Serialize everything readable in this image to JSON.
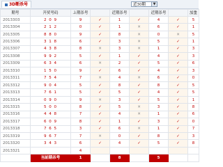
{
  "tab": {
    "title": "3D断杀号"
  },
  "filter": {
    "selected": "近30期"
  },
  "columns": [
    "期号",
    "开奖号码",
    "上期杀号",
    "",
    "近期杀号",
    "",
    "近期杀号",
    "",
    "加重"
  ],
  "rows": [
    {
      "issue": "2013303",
      "draw": "2 0 9",
      "k1": "9",
      "m1": "✓",
      "k2": "1",
      "m2": "✓",
      "k3": "4",
      "m3": "✓",
      "w": "5"
    },
    {
      "issue": "2013304",
      "draw": "2 1 2",
      "k1": "0",
      "m1": "✓",
      "k2": "1",
      "m2": "✕",
      "k3": "6",
      "m3": "✓",
      "w": "1"
    },
    {
      "issue": "2013305",
      "draw": "8 8 0",
      "k1": "9",
      "m1": "✓",
      "k2": "8",
      "m2": "✕",
      "k3": "0",
      "m3": "✕",
      "w": "5"
    },
    {
      "issue": "2013306",
      "draw": "3 1 8",
      "k1": "6",
      "m1": "✓",
      "k2": "3",
      "m2": "✕",
      "k3": "5",
      "m3": "✓",
      "w": "1"
    },
    {
      "issue": "2013307",
      "draw": "4 3 8",
      "k1": "8",
      "m1": "✕",
      "k2": "3",
      "m2": "✕",
      "k3": "1",
      "m3": "✓",
      "w": "3"
    },
    {
      "issue": "2013308",
      "draw": "9 9 2",
      "k1": "5",
      "m1": "✓",
      "k2": "1",
      "m2": "✓",
      "k3": "4",
      "m3": "✓",
      "w": "3"
    },
    {
      "issue": "2013309",
      "draw": "6 3 4",
      "k1": "6",
      "m1": "✕",
      "k2": "2",
      "m2": "✓",
      "k3": "5",
      "m3": "✓",
      "w": "6"
    },
    {
      "issue": "2013310",
      "draw": "1 5 0",
      "k1": "9",
      "m1": "✓",
      "k2": "6",
      "m2": "✓",
      "k3": "4",
      "m3": "✓",
      "w": "3"
    },
    {
      "issue": "2013311",
      "draw": "7 5 4",
      "k1": "7",
      "m1": "✕",
      "k2": "4",
      "m2": "✕",
      "k3": "6",
      "m3": "✓",
      "w": "0"
    },
    {
      "issue": "2013312",
      "draw": "9 0 4",
      "k1": "5",
      "m1": "✓",
      "k2": "8",
      "m2": "✓",
      "k3": "8",
      "m3": "✓",
      "w": "5"
    },
    {
      "issue": "2013313",
      "draw": "7 6 1",
      "k1": "5",
      "m1": "✓",
      "k2": "5",
      "m2": "✓",
      "k3": "4",
      "m3": "✓",
      "w": "5"
    },
    {
      "issue": "2013314",
      "draw": "0 9 0",
      "k1": "9",
      "m1": "✕",
      "k2": "3",
      "m2": "✓",
      "k3": "5",
      "m3": "✓",
      "w": "1"
    },
    {
      "issue": "2013315",
      "draw": "5 0 0",
      "k1": "8",
      "m1": "✓",
      "k2": "5",
      "m2": "✕",
      "k3": "3",
      "m3": "✓",
      "w": "8"
    },
    {
      "issue": "2013316",
      "draw": "4 4 8",
      "k1": "7",
      "m1": "✓",
      "k2": "4",
      "m2": "✕",
      "k3": "1",
      "m3": "✓",
      "w": "6"
    },
    {
      "issue": "2013317",
      "draw": "6 0 9",
      "k1": "8",
      "m1": "✓",
      "k2": "1",
      "m2": "✓",
      "k3": "3",
      "m3": "✓",
      "w": "0"
    },
    {
      "issue": "2013318",
      "draw": "7 6 5",
      "k1": "3",
      "m1": "✓",
      "k2": "6",
      "m2": "✕",
      "k3": "1",
      "m3": "✓",
      "w": "7"
    },
    {
      "issue": "2013319",
      "draw": "9 6 7",
      "k1": "7",
      "m1": "✕",
      "k2": "0",
      "m2": "✓",
      "k3": "8",
      "m3": "✓",
      "w": "3"
    },
    {
      "issue": "2013320",
      "draw": "3 4 3",
      "k1": "6",
      "m1": "✓",
      "k2": "4",
      "m2": "✓",
      "k3": "5",
      "m3": "✓",
      "w": "8"
    },
    {
      "issue": "2013321",
      "draw": "",
      "k1": "4",
      "m1": "",
      "k2": "",
      "m2": "",
      "k3": "",
      "m3": "",
      "w": ""
    }
  ],
  "footer": {
    "label": "当前期杀号",
    "k1": "1",
    "k2": "8",
    "k3": "5"
  }
}
